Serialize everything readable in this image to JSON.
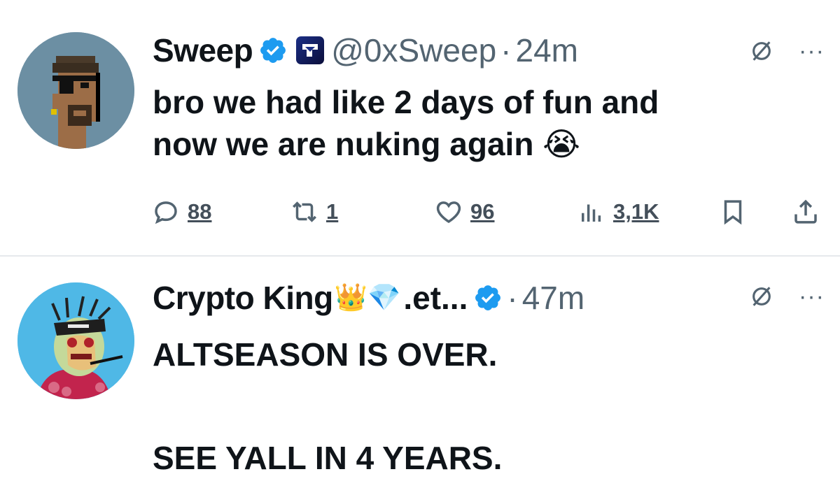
{
  "tweets": [
    {
      "author_name": "Sweep",
      "handle": "@0xSweep",
      "separator": "·",
      "time": "24m",
      "text": "bro we had like 2 days of fun and\nnow we are nuking again 😭",
      "verified": true,
      "avatar_icon": "pixel-punk-avatar",
      "actions": {
        "replies": "88",
        "reposts": "1",
        "likes": "96",
        "views": "3,1K"
      }
    },
    {
      "author_name": "Crypto King",
      "name_emojis": "👑💎",
      "name_suffix": ".et...",
      "separator": "·",
      "time": "47m",
      "text": "ALTSEASON IS OVER.\n\nSEE YALL IN 4 YEARS.",
      "verified": true,
      "avatar_icon": "zombie-ape-avatar"
    }
  ],
  "more_label": "···",
  "colors": {
    "verified_blue": "#1d9bf0",
    "muted_gray": "#536471",
    "divider": "#e6e9ec"
  }
}
